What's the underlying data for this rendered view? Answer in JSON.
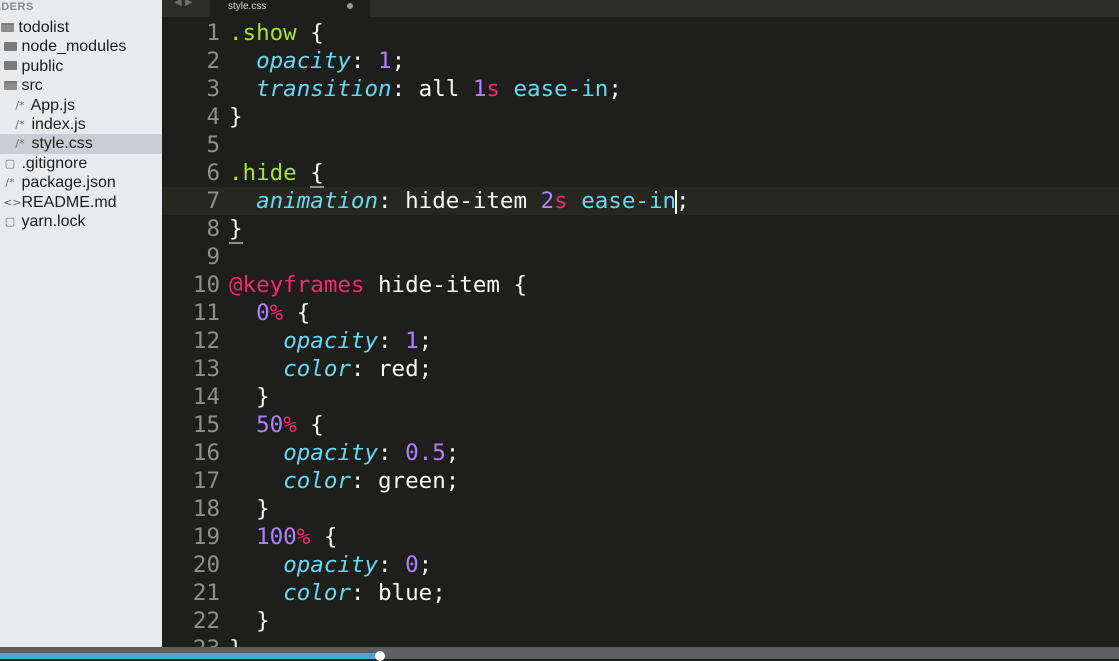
{
  "sidebar": {
    "header": "LDERS",
    "items": [
      {
        "label": "todolist",
        "icon": "folder-open-icon",
        "kind": "folder-open",
        "indent": 0
      },
      {
        "label": "node_modules",
        "icon": "folder-icon",
        "kind": "folder",
        "indent": 1
      },
      {
        "label": "public",
        "icon": "folder-icon",
        "kind": "folder",
        "indent": 1
      },
      {
        "label": "src",
        "icon": "folder-open-icon",
        "kind": "folder-open",
        "indent": 1
      },
      {
        "label": "App.js",
        "icon": "comment-file-icon",
        "kind": "code",
        "indent": 2
      },
      {
        "label": "index.js",
        "icon": "comment-file-icon",
        "kind": "code",
        "indent": 2
      },
      {
        "label": "style.css",
        "icon": "comment-file-icon",
        "kind": "code",
        "indent": 2,
        "selected": true
      },
      {
        "label": ".gitignore",
        "icon": "file-icon",
        "kind": "file",
        "indent": 1
      },
      {
        "label": "package.json",
        "icon": "comment-file-icon",
        "kind": "code",
        "indent": 1
      },
      {
        "label": "README.md",
        "icon": "markup-file-icon",
        "kind": "markup",
        "indent": 1
      },
      {
        "label": "yarn.lock",
        "icon": "file-icon",
        "kind": "file",
        "indent": 1
      }
    ]
  },
  "tabs": {
    "arrows": "◀ ▶",
    "active": {
      "title": "style.css",
      "modified": true
    }
  },
  "editor": {
    "current_line": 7,
    "lines": [
      [
        {
          "t": ".show",
          "c": "sel"
        },
        {
          "t": " {"
        }
      ],
      [
        {
          "t": "  "
        },
        {
          "t": "opacity",
          "c": "prop"
        },
        {
          "t": ": "
        },
        {
          "t": "1",
          "c": "num"
        },
        {
          "t": ";"
        }
      ],
      [
        {
          "t": "  "
        },
        {
          "t": "transition",
          "c": "prop"
        },
        {
          "t": ": all "
        },
        {
          "t": "1",
          "c": "num"
        },
        {
          "t": "s",
          "c": "unit"
        },
        {
          "t": " "
        },
        {
          "t": "ease-in",
          "c": "val"
        },
        {
          "t": ";"
        }
      ],
      [
        {
          "t": "}"
        }
      ],
      [
        {
          "t": ""
        }
      ],
      [
        {
          "t": ".hide",
          "c": "sel"
        },
        {
          "t": " "
        },
        {
          "t": "{",
          "c": "brace-match"
        }
      ],
      [
        {
          "t": "  "
        },
        {
          "t": "animation",
          "c": "prop"
        },
        {
          "t": ": hide-item "
        },
        {
          "t": "2",
          "c": "num"
        },
        {
          "t": "s",
          "c": "unit"
        },
        {
          "t": " "
        },
        {
          "t": "ease-in",
          "c": "val"
        },
        {
          "t": "",
          "c": "cursor"
        },
        {
          "t": ";"
        }
      ],
      [
        {
          "t": "}",
          "c": "brace-match"
        }
      ],
      [
        {
          "t": ""
        }
      ],
      [
        {
          "t": "@keyframes",
          "c": "at"
        },
        {
          "t": " hide-item {"
        }
      ],
      [
        {
          "t": "  "
        },
        {
          "t": "0",
          "c": "num"
        },
        {
          "t": "%",
          "c": "pct"
        },
        {
          "t": " {"
        }
      ],
      [
        {
          "t": "    "
        },
        {
          "t": "opacity",
          "c": "prop"
        },
        {
          "t": ": "
        },
        {
          "t": "1",
          "c": "num"
        },
        {
          "t": ";"
        }
      ],
      [
        {
          "t": "    "
        },
        {
          "t": "color",
          "c": "prop"
        },
        {
          "t": ": red;"
        }
      ],
      [
        {
          "t": "  }"
        }
      ],
      [
        {
          "t": "  "
        },
        {
          "t": "50",
          "c": "num"
        },
        {
          "t": "%",
          "c": "pct"
        },
        {
          "t": " {"
        }
      ],
      [
        {
          "t": "    "
        },
        {
          "t": "opacity",
          "c": "prop"
        },
        {
          "t": ": "
        },
        {
          "t": "0.5",
          "c": "num"
        },
        {
          "t": ";"
        }
      ],
      [
        {
          "t": "    "
        },
        {
          "t": "color",
          "c": "prop"
        },
        {
          "t": ": green;"
        }
      ],
      [
        {
          "t": "  }"
        }
      ],
      [
        {
          "t": "  "
        },
        {
          "t": "100",
          "c": "num"
        },
        {
          "t": "%",
          "c": "pct"
        },
        {
          "t": " {"
        }
      ],
      [
        {
          "t": "    "
        },
        {
          "t": "opacity",
          "c": "prop"
        },
        {
          "t": ": "
        },
        {
          "t": "0",
          "c": "num"
        },
        {
          "t": ";"
        }
      ],
      [
        {
          "t": "    "
        },
        {
          "t": "color",
          "c": "prop"
        },
        {
          "t": ": blue;"
        }
      ],
      [
        {
          "t": "  }"
        }
      ],
      [
        {
          "t": "}"
        }
      ]
    ]
  },
  "player": {
    "progress": 0.34
  },
  "colors": {
    "editor_bg": "#1e1f1c",
    "selector": "#a6e22e",
    "property": "#66d9ef",
    "number": "#ae81ff",
    "unit": "#f92672",
    "progress": "#4aa6d9"
  }
}
